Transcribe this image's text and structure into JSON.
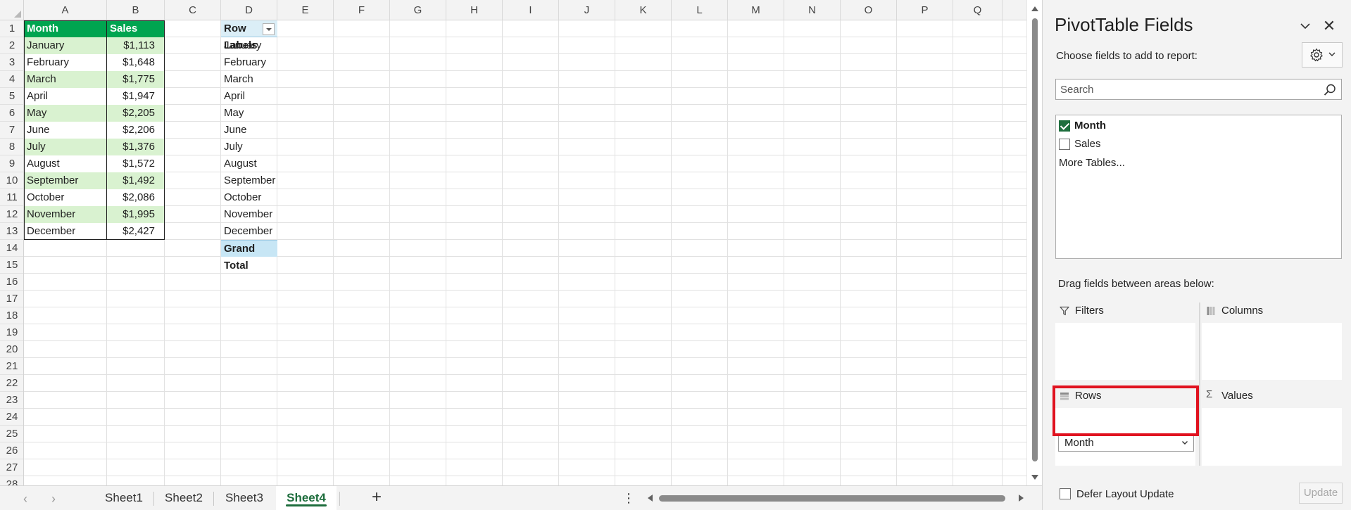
{
  "sheet": {
    "columns": [
      "A",
      "B",
      "C",
      "D",
      "E",
      "F",
      "G",
      "H",
      "I",
      "J",
      "K",
      "L",
      "M",
      "N",
      "O",
      "P",
      "Q"
    ],
    "rows": [
      "1",
      "2",
      "3",
      "4",
      "5",
      "6",
      "7",
      "8",
      "9",
      "10",
      "11",
      "12",
      "13",
      "14",
      "15",
      "16",
      "17",
      "18",
      "19",
      "20",
      "21",
      "22",
      "23",
      "24",
      "25",
      "26",
      "27",
      "28"
    ],
    "table": {
      "headers": [
        "Month",
        "Sales"
      ],
      "data": [
        [
          "January",
          "$1,113"
        ],
        [
          "February",
          "$1,648"
        ],
        [
          "March",
          "$1,775"
        ],
        [
          "April",
          "$1,947"
        ],
        [
          "May",
          "$2,205"
        ],
        [
          "June",
          "$2,206"
        ],
        [
          "July",
          "$1,376"
        ],
        [
          "August",
          "$1,572"
        ],
        [
          "September",
          "$1,492"
        ],
        [
          "October",
          "$2,086"
        ],
        [
          "November",
          "$1,995"
        ],
        [
          "December",
          "$2,427"
        ]
      ]
    },
    "pivot": {
      "row_labels_header": "Row Labels",
      "items": [
        "January",
        "February",
        "March",
        "April",
        "May",
        "June",
        "July",
        "August",
        "September",
        "October",
        "November",
        "December"
      ],
      "grand_total": "Grand Total"
    }
  },
  "tabs": {
    "sheets": [
      "Sheet1",
      "Sheet2",
      "Sheet3",
      "Sheet4"
    ],
    "active": "Sheet4",
    "add_label": "+",
    "menu_label": "⋮"
  },
  "pivot_panel": {
    "title": "PivotTable Fields",
    "close_label": "✕",
    "choose_label": "Choose fields to add to report:",
    "search_placeholder": "Search",
    "fields": [
      {
        "name": "Month",
        "checked": true
      },
      {
        "name": "Sales",
        "checked": false
      }
    ],
    "more_tables": "More Tables...",
    "drag_label": "Drag fields between areas below:",
    "areas": {
      "filters": "Filters",
      "columns": "Columns",
      "rows": "Rows",
      "values": "Values"
    },
    "rows_field": "Month",
    "values_icon": "Σ",
    "defer_label": "Defer Layout Update",
    "update_label": "Update"
  },
  "colors": {
    "table_header": "#00a550",
    "table_band": "#d9f2d0",
    "pivot_header": "#dbeef7",
    "pivot_total": "#c7e6f5",
    "accent": "#1e6e3d",
    "highlight": "#e0121f"
  }
}
